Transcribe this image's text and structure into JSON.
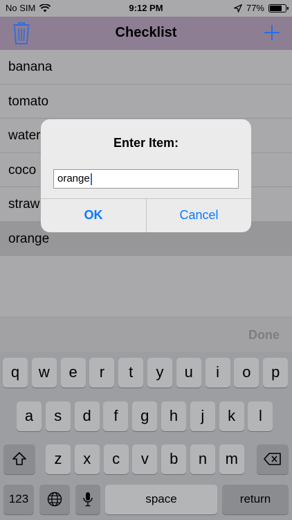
{
  "status_bar": {
    "carrier": "No SIM",
    "time": "9:12 PM",
    "battery_text": "77%",
    "battery_level": 0.77
  },
  "nav": {
    "title": "Checklist",
    "trash_icon": "trash-icon",
    "add_icon": "plus-icon",
    "accent_color": "#2a6de3"
  },
  "list": {
    "items": [
      {
        "label": "banana"
      },
      {
        "label": "tomato"
      },
      {
        "label": "water"
      },
      {
        "label": "coco"
      },
      {
        "label": "straw"
      },
      {
        "label": "orange",
        "selected": true
      }
    ]
  },
  "alert": {
    "title": "Enter Item:",
    "input_value": "orange",
    "ok_label": "OK",
    "cancel_label": "Cancel"
  },
  "keyboard": {
    "done_label": "Done",
    "row1": [
      "q",
      "w",
      "e",
      "r",
      "t",
      "y",
      "u",
      "i",
      "o",
      "p"
    ],
    "row2": [
      "a",
      "s",
      "d",
      "f",
      "g",
      "h",
      "j",
      "k",
      "l"
    ],
    "row3": [
      "z",
      "x",
      "c",
      "v",
      "b",
      "n",
      "m"
    ],
    "numbers_label": "123",
    "space_label": "space",
    "return_label": "return"
  }
}
